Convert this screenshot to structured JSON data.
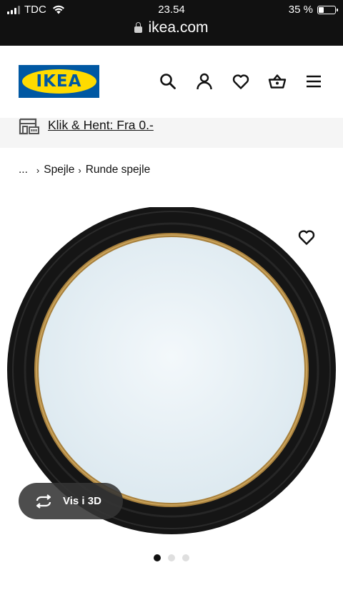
{
  "status_bar": {
    "carrier": "TDC",
    "time": "23.54",
    "battery_percent": "35 %",
    "battery_level": 0.35,
    "url": "ikea.com"
  },
  "header": {
    "logo_text": "IKEA",
    "icons": [
      "search-icon",
      "profile-icon",
      "heart-icon",
      "basket-icon",
      "menu-icon"
    ]
  },
  "click_collect": {
    "link_text": "Klik & Hent: Fra 0.-"
  },
  "breadcrumb": {
    "ellipsis": "...",
    "items": [
      "Spejle",
      "Runde spejle"
    ]
  },
  "product": {
    "view3d_label": "Vis i 3D",
    "image_count": 3,
    "active_image": 0
  },
  "colors": {
    "ikea_blue": "#0058a3",
    "ikea_yellow": "#ffdb00",
    "frame_black": "#151515",
    "gold_rim": "#b08a45",
    "mirror": "#e8f1f6"
  }
}
